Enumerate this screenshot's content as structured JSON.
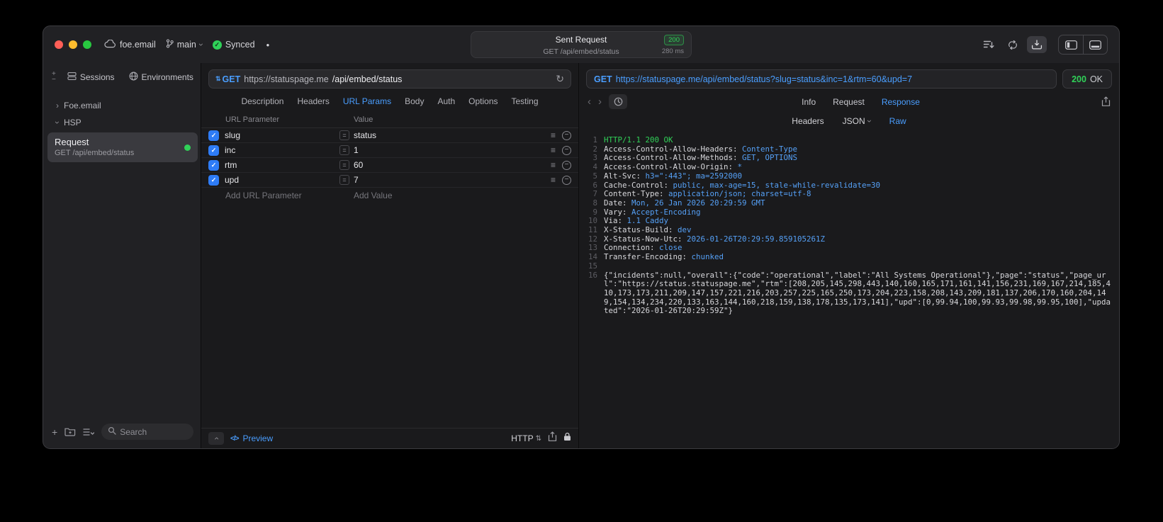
{
  "colors": {
    "accent_blue": "#4a9eff",
    "success_green": "#30d158"
  },
  "icons": {
    "check": "✓",
    "chevron": "›",
    "back": "‹",
    "forward": "›",
    "plus": "+",
    "minus": "−",
    "hamburger": "≡",
    "equals": "=",
    "updown": "⇅",
    "refresh": "↻",
    "dot": "●",
    "code": "</>"
  },
  "titlebar": {
    "project": "foe.email",
    "branch": "main",
    "sync": "Synced",
    "request_summary": {
      "title": "Sent Request",
      "status_code": "200",
      "method_path": "GET /api/embed/status",
      "duration": "280 ms"
    }
  },
  "sidebar": {
    "tabs": {
      "sessions": "Sessions",
      "environments": "Environments"
    },
    "groups": {
      "foe_email": "Foe.email",
      "hsp": "HSP"
    },
    "request_item": {
      "title": "Request",
      "subtitle": "GET /api/embed/status"
    },
    "search_placeholder": "Search"
  },
  "request_editor": {
    "method": "GET",
    "url_host": "https://statuspage.me",
    "url_path": "/api/embed/status",
    "tabs": [
      "Description",
      "Headers",
      "URL Params",
      "Body",
      "Auth",
      "Options",
      "Testing"
    ],
    "active_tab": "URL Params",
    "params": {
      "col_name": "URL Parameter",
      "col_value": "Value",
      "rows": [
        {
          "name": "slug",
          "value": "status",
          "checked": true
        },
        {
          "name": "inc",
          "value": "1",
          "checked": true
        },
        {
          "name": "rtm",
          "value": "60",
          "checked": true
        },
        {
          "name": "upd",
          "value": "7",
          "checked": true
        }
      ],
      "add_name": "Add URL Parameter",
      "add_value": "Add Value"
    },
    "footer": {
      "preview": "Preview",
      "protocol": "HTTP"
    }
  },
  "response_viewer": {
    "request_method": "GET",
    "request_url": "https://statuspage.me/api/embed/status?slug=status&inc=1&rtm=60&upd=7",
    "status_code": "200",
    "status_text": "OK",
    "tabs": [
      "Info",
      "Request",
      "Response"
    ],
    "active_tab": "Response",
    "subtabs": [
      "Headers",
      "JSON",
      "Raw"
    ],
    "active_subtab": "Raw",
    "lines": [
      {
        "n": "1",
        "text": "HTTP/1.1 200 OK"
      },
      {
        "n": "2",
        "name": "Access-Control-Allow-Headers:",
        "value": " Content-Type"
      },
      {
        "n": "3",
        "name": "Access-Control-Allow-Methods:",
        "value": " GET, OPTIONS"
      },
      {
        "n": "4",
        "name": "Access-Control-Allow-Origin:",
        "value": " *"
      },
      {
        "n": "5",
        "name": "Alt-Svc:",
        "value": " h3=\":443\"; ma=2592000"
      },
      {
        "n": "6",
        "name": "Cache-Control:",
        "value": " public, max-age=15, stale-while-revalidate=30"
      },
      {
        "n": "7",
        "name": "Content-Type:",
        "value": " application/json; charset=utf-8"
      },
      {
        "n": "8",
        "name": "Date:",
        "value": " Mon, 26 Jan 2026 20:29:59 GMT"
      },
      {
        "n": "9",
        "name": "Vary:",
        "value": " Accept-Encoding"
      },
      {
        "n": "10",
        "name": "Via:",
        "value": " 1.1 Caddy"
      },
      {
        "n": "11",
        "name": "X-Status-Build:",
        "value": " dev"
      },
      {
        "n": "12",
        "name": "X-Status-Now-Utc:",
        "value": " 2026-01-26T20:29:59.859105261Z"
      },
      {
        "n": "13",
        "name": "Connection:",
        "value": " close"
      },
      {
        "n": "14",
        "name": "Transfer-Encoding:",
        "value": " chunked"
      },
      {
        "n": "15",
        "name": "",
        "value": ""
      },
      {
        "n": "16",
        "text": "{\"incidents\":null,\"overall\":{\"code\":\"operational\",\"label\":\"All Systems Operational\"},\"page\":\"status\",\"page_url\":\"https://status.statuspage.me\",\"rtm\":[208,205,145,298,443,140,160,165,171,161,141,156,231,169,167,214,185,410,173,173,211,209,147,157,221,216,203,257,225,165,250,173,204,223,158,208,143,209,181,137,206,170,160,204,149,154,134,234,220,133,163,144,160,218,159,138,178,135,173,141],\"upd\":[0,99.94,100,99.93,99.98,99.95,100],\"updated\":\"2026-01-26T20:29:59Z\"}"
      }
    ]
  }
}
